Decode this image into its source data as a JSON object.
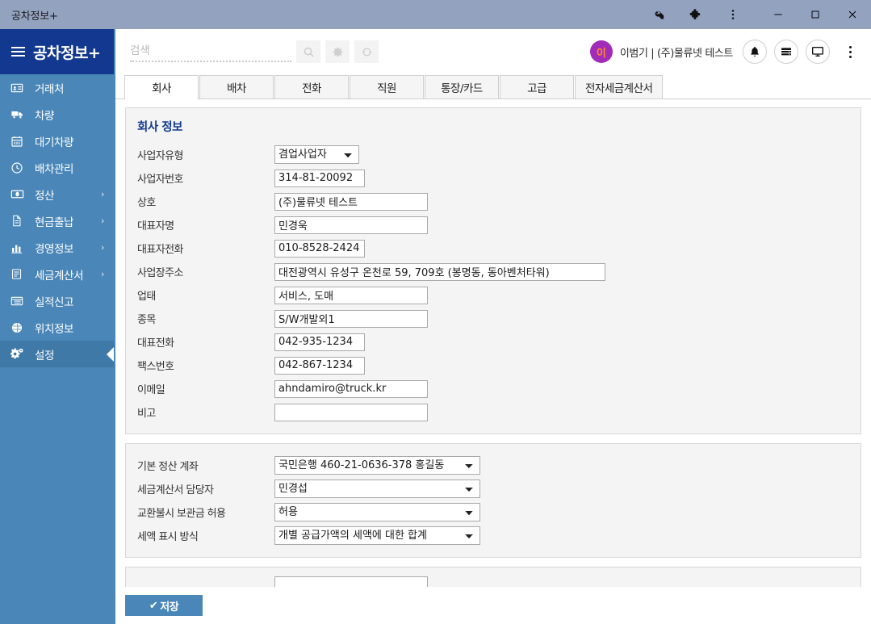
{
  "window": {
    "title": "공차정보+",
    "icons": [
      "key-icon",
      "puzzle-icon",
      "kebab-menu-icon",
      "minimize-icon",
      "maximize-icon",
      "close-icon"
    ]
  },
  "brand": {
    "text": "공차정보+",
    "menu_icon": "hamburger-icon"
  },
  "sidebar": {
    "items": [
      {
        "label": "거래처",
        "icon": "id-card-icon",
        "chevron": "",
        "active": false
      },
      {
        "label": "차량",
        "icon": "truck-icon",
        "chevron": "",
        "active": false
      },
      {
        "label": "대기차량",
        "icon": "calendar-icon",
        "chevron": "",
        "active": false
      },
      {
        "label": "배차관리",
        "icon": "clock-icon",
        "chevron": "",
        "active": false
      },
      {
        "label": "정산",
        "icon": "money-icon",
        "chevron": "›",
        "active": false
      },
      {
        "label": "현금출납",
        "icon": "document-icon",
        "chevron": "›",
        "active": false
      },
      {
        "label": "경영정보",
        "icon": "chart-icon",
        "chevron": "›",
        "active": false
      },
      {
        "label": "세금계산서",
        "icon": "invoice-icon",
        "chevron": "›",
        "active": false
      },
      {
        "label": "실적신고",
        "icon": "list-icon",
        "chevron": "",
        "active": false
      },
      {
        "label": "위치정보",
        "icon": "globe-icon",
        "chevron": "",
        "active": false
      },
      {
        "label": "설정",
        "icon": "gears-icon",
        "chevron": "",
        "active": true
      }
    ]
  },
  "topbar": {
    "search": {
      "value": "",
      "placeholder": "검색"
    },
    "buttons": [
      "search-icon",
      "gear-icon",
      "refresh-icon"
    ],
    "avatar_initial": "이",
    "user_text": "이범기 | (주)물류넷 테스트",
    "circle_buttons": [
      "bell-icon",
      "server-list-icon",
      "monitor-icon"
    ],
    "kebab": "kebab-menu-icon"
  },
  "tabs": [
    {
      "label": "회사",
      "active": true
    },
    {
      "label": "배차",
      "active": false
    },
    {
      "label": "전화",
      "active": false
    },
    {
      "label": "직원",
      "active": false
    },
    {
      "label": "통장/카드",
      "active": false
    },
    {
      "label": "고급",
      "active": false
    },
    {
      "label": "전자세금계산서",
      "active": false
    }
  ],
  "company_panel": {
    "title": "회사 정보",
    "fields": [
      {
        "label": "사업자유형",
        "value": "겸업사업자",
        "type": "select",
        "width": "w-105"
      },
      {
        "label": "사업자번호",
        "value": "314-81-20092",
        "type": "text",
        "width": "w-110"
      },
      {
        "label": "상호",
        "value": "(주)물류넷 테스트",
        "type": "text",
        "width": "w-190"
      },
      {
        "label": "대표자명",
        "value": "민경욱",
        "type": "text",
        "width": "w-190"
      },
      {
        "label": "대표자전화",
        "value": "010-8528-2424",
        "type": "text",
        "width": "w-110"
      },
      {
        "label": "사업장주소",
        "value": "대전광역시 유성구 온천로 59, 709호 (봉명동, 동아벤처타워)",
        "type": "text",
        "width": "w-410"
      },
      {
        "label": "업태",
        "value": "서비스, 도매",
        "type": "text",
        "width": "w-190"
      },
      {
        "label": "종목",
        "value": "S/W개발외1",
        "type": "text",
        "width": "w-190"
      },
      {
        "label": "대표전화",
        "value": "042-935-1234",
        "type": "text",
        "width": "w-110"
      },
      {
        "label": "팩스번호",
        "value": "042-867-1234",
        "type": "text",
        "width": "w-110"
      },
      {
        "label": "이메일",
        "value": "ahndamiro@truck.kr",
        "type": "text",
        "width": "w-190"
      },
      {
        "label": "비고",
        "value": "",
        "type": "text",
        "width": "w-190"
      }
    ]
  },
  "settings_panel": {
    "fields": [
      {
        "label": "기본 정산 계좌",
        "value": "국민은행 460-21-0636-378 홍길동",
        "type": "select",
        "width": "w-255sel"
      },
      {
        "label": "세금계산서 담당자",
        "value": "민경섭",
        "type": "select",
        "width": "w-255sel"
      },
      {
        "label": "교환불시 보관금 허용",
        "value": "허용",
        "type": "select",
        "width": "w-255sel"
      },
      {
        "label": "세액 표시 방식",
        "value": "개별 공급가액의 세액에 대한 합계",
        "type": "select",
        "width": "w-255sel"
      }
    ]
  },
  "third_panel": {
    "fields": [
      {
        "label": "",
        "value": "",
        "type": "text",
        "width": "w-190"
      }
    ]
  },
  "savebar": {
    "label": "저장",
    "check": "✔",
    "icon": "check-icon"
  },
  "colors": {
    "brand_navy": "#12388f",
    "sidebar_blue": "#4a87b8",
    "sidebar_active": "#3e79a8",
    "titlebar": "#93a2bf",
    "panel_bg": "#f4f4f4",
    "avatar_bg": "#a22bb8",
    "avatar_fg": "#ff8a2b",
    "save_button": "#4a87b8"
  }
}
